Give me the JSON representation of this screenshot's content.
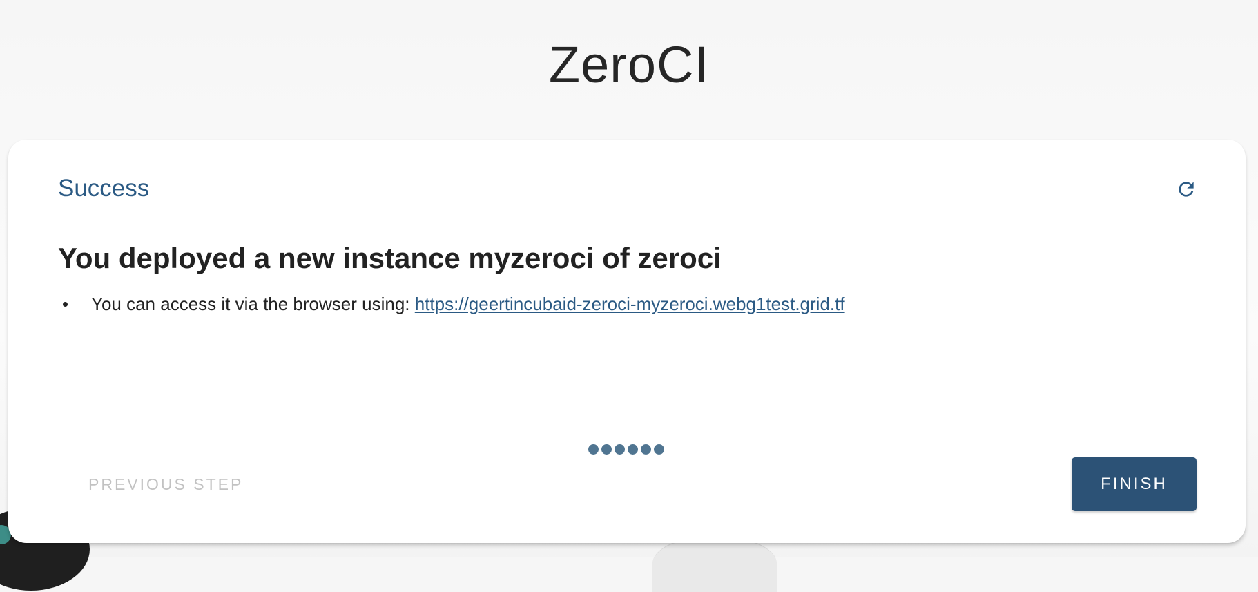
{
  "app": {
    "title": "ZeroCI"
  },
  "step": {
    "title": "Success",
    "refresh_icon": "refresh-icon"
  },
  "content": {
    "heading": "You deployed a new instance myzeroci of zeroci",
    "items": [
      {
        "text": "You can access it via the browser using: ",
        "link": "https://geertincubaid-zeroci-myzeroci.webg1test.grid.tf"
      }
    ]
  },
  "stepper": {
    "total_steps": 6,
    "dot_color": "#507591"
  },
  "actions": {
    "previous_label": "PREVIOUS STEP",
    "finish_label": "FINISH"
  },
  "colors": {
    "accent": "#2b5a84",
    "primary_button": "#2c5276",
    "disabled_text": "#c2c2c2"
  }
}
